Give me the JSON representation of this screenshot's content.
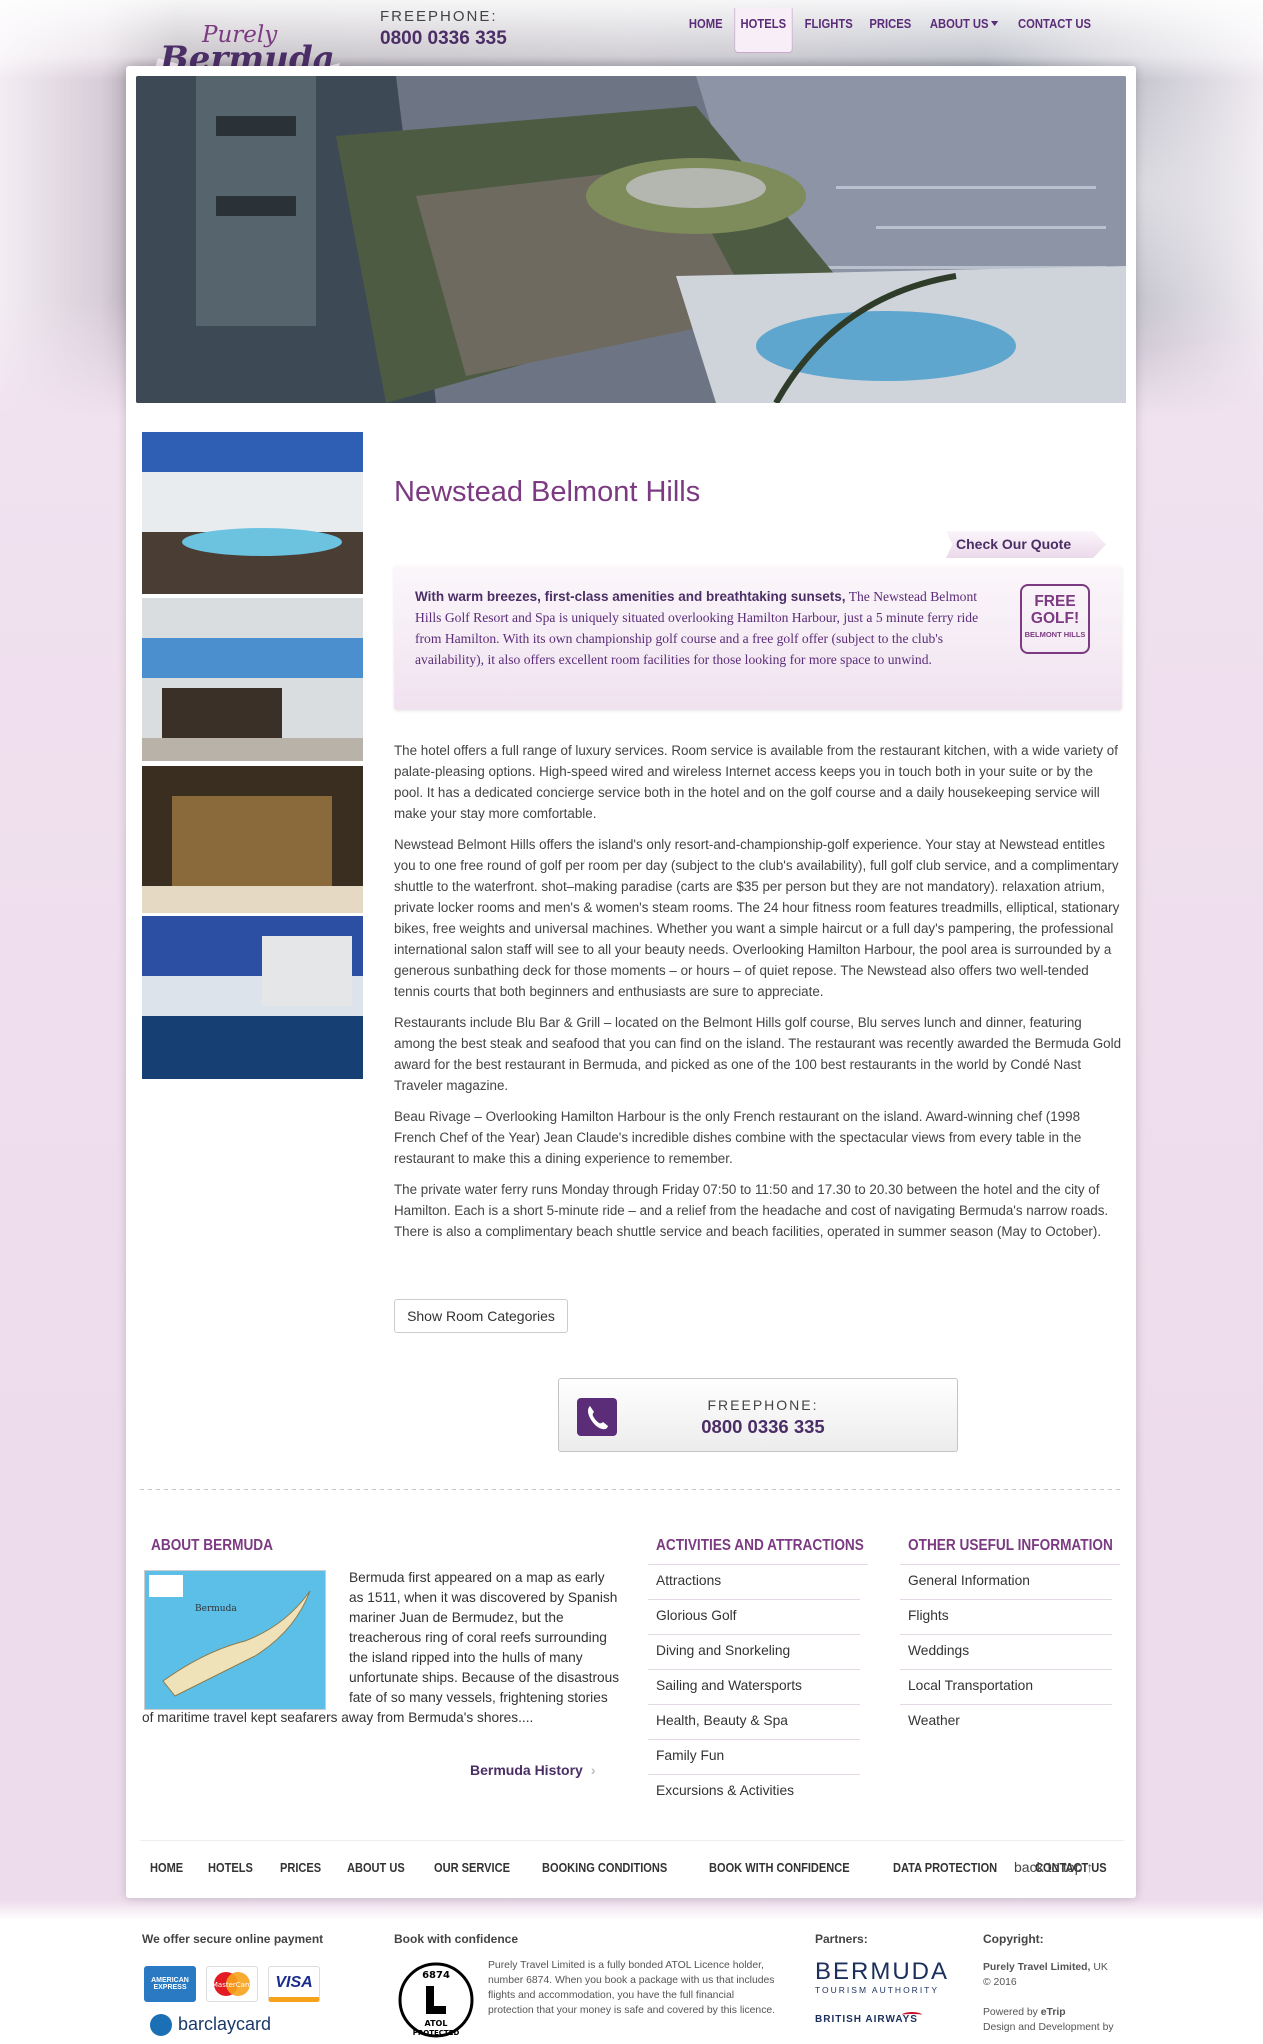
{
  "header": {
    "logo_text_top": "Purely",
    "logo_text_bottom": "Bermuda",
    "freephone_label": "FREEPHONE:",
    "freephone_number": "0800 0336 335"
  },
  "nav": {
    "items": [
      "HOME",
      "HOTELS",
      "FLIGHTS",
      "PRICES",
      "ABOUT US",
      "CONTACT US"
    ],
    "active": "HOTELS"
  },
  "hotel": {
    "title": "Newstead Belmont Hills",
    "quote_button": "Check Our Quote",
    "intro_lead": "With warm breezes, first-class amenities and breathtaking sunsets,",
    "intro_rest": "The Newstead Belmont Hills Golf Resort and Spa is uniquely situated overlooking Hamilton Harbour, just a 5 minute ferry ride from Hamilton. With its own championship golf course and a free golf offer (subject to the club's availability), it also offers excellent room facilities for those looking for more space to unwind.",
    "badge_big": "FREE GOLF!",
    "badge_small": "BELMONT HILLS",
    "paragraphs": [
      "The hotel offers a full range of luxury services. Room service is available from the restaurant kitchen, with a wide variety of palate-pleasing options. High-speed wired and wireless Internet access keeps you in touch both in your suite or by the pool. It has a dedicated concierge service both in the hotel and on the golf course and a daily housekeeping service will make your stay more comfortable.",
      "Newstead Belmont Hills offers the island's only resort-and-championship-golf experience. Your stay at Newstead entitles you to one free round of golf per room per day (subject to the club's availability), full golf club service, and a complimentary shuttle to the waterfront. shot–making paradise (carts are $35 per person but they are not mandatory). relaxation atrium, private locker rooms and men's & women's steam rooms. The 24 hour fitness room features treadmills, elliptical, stationary bikes, free weights and universal machines. Whether you want a simple haircut or a full day's pampering, the professional international salon staff will see to all your beauty needs. Overlooking Hamilton Harbour, the pool area is surrounded by a generous sunbathing deck for those moments – or hours – of quiet repose. The Newstead also offers two well-tended tennis courts that both beginners and enthusiasts are sure to appreciate.",
      "Restaurants include Blu Bar & Grill – located on the Belmont Hills golf course, Blu serves lunch and dinner, featuring among the best steak and seafood that you can find on the island. The restaurant was recently awarded the Bermuda Gold award for the best restaurant in Bermuda, and picked as one of the 100 best restaurants in the world by Condé Nast Traveler magazine.",
      "Beau Rivage – Overlooking Hamilton Harbour is the only French restaurant on the island. Award-winning chef (1998 French Chef of the Year) Jean Claude's incredible dishes combine with the spectacular views from every table in the restaurant to make this a dining experience to remember.",
      "The private water ferry runs Monday through Friday 07:50 to 11:50 and 17.30 to 20.30 between the hotel and the city of Hamilton. Each is a short 5-minute ride – and a relief from the headache and cost of navigating Bermuda's narrow roads. There is also a complimentary beach shuttle service and beach facilities, operated in summer season (May to October)."
    ],
    "show_rooms_button": "Show Room Categories"
  },
  "freephone_box": {
    "label": "FREEPHONE:",
    "number": "0800 0336 335"
  },
  "footer": {
    "about": {
      "heading": "ABOUT BERMUDA",
      "text": "Bermuda first appeared on a map as early as 1511, when it was discovered by Spanish mariner Juan de Bermudez, but the treacherous ring of coral reefs surrounding the island ripped into the hulls of many unfortunate ships. Because of the disastrous fate of so many vessels, frightening stories of maritime travel kept seafarers away from Bermuda's shores....",
      "link": "Bermuda History",
      "map_label": "Bermuda"
    },
    "activities": {
      "heading": "ACTIVITIES AND ATTRACTIONS",
      "items": [
        "Attractions",
        "Glorious Golf",
        "Diving and Snorkeling",
        "Sailing and Watersports",
        "Health, Beauty & Spa",
        "Family Fun",
        "Excursions & Activities"
      ]
    },
    "other": {
      "heading": "OTHER USEFUL INFORMATION",
      "items": [
        "General Information",
        "Flights",
        "Weddings",
        "Local Transportation",
        "Weather"
      ]
    },
    "bottom_nav": [
      "HOME",
      "HOTELS",
      "PRICES",
      "ABOUT US",
      "OUR SERVICE",
      "BOOKING CONDITIONS",
      "BOOK WITH CONFIDENCE",
      "DATA PROTECTION",
      "CONTACT US"
    ],
    "back_to_top": "back to top"
  },
  "legal": {
    "payment_heading": "We offer secure online payment",
    "card_amex": "AMERICAN EXPRESS",
    "card_mc": "MasterCard",
    "card_visa": "VISA",
    "barclaycard": "barclaycard",
    "confidence_heading": "Book with confidence",
    "confidence_text": "Purely Travel Limited is a fully bonded ATOL Licence holder, number 6874. When you book a package with us that includes flights and accommodation, you have the full financial protection that your money is safe and covered by this licence.",
    "atol_number": "6874",
    "atol_word": "ATOL",
    "atol_protected": "PROTECTED",
    "partners_heading": "Partners:",
    "partner1": "BERMUDA",
    "partner1_sub": "TOURISM AUTHORITY",
    "partner2": "BRITISH AIRWAYS",
    "copyright_heading": "Copyright:",
    "company": "Purely Travel Limited,",
    "company_country": "UK",
    "year": "© 2016",
    "powered_by": "Powered by",
    "powered_name": "eTrip",
    "design_dev": "Design and Development by"
  },
  "colors": {
    "brand_purple": "#5b2c78",
    "title_purple": "#7b3a81",
    "accent_lilac": "#f1e2f0"
  }
}
